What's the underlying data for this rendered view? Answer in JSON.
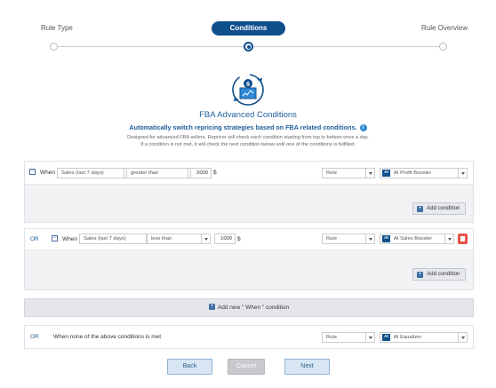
{
  "stepper": {
    "steps": [
      "Rule Type",
      "Conditions",
      "Rule Overview"
    ],
    "active_index": 1
  },
  "header": {
    "title": "FBA Advanced Conditions",
    "subtitle": "Automatically switch repricing strategies based on FBA related conditions.",
    "desc_line1": "Designed for advanced FBA sellers. Repricer will check each condition starting from top to bottom once a day.",
    "desc_line2": "If a condition is not met, it will check the next condition below until one of the conditions is fulfilled."
  },
  "conditions": [
    {
      "prefix": "",
      "when_label": "When",
      "metric": "Sales (last 7 days)",
      "operator": "greater than",
      "value": "2000",
      "unit": "$",
      "action_type": "Rule",
      "ai_badge": "AI",
      "strategy": "AI Profit Booster",
      "add_condition_label": "Add condition"
    },
    {
      "prefix": "OR",
      "when_label": "When",
      "metric": "Sales (last 7 days)",
      "operator": "less than",
      "value": "1000",
      "unit": "$",
      "action_type": "Rule",
      "ai_badge": "AI",
      "strategy": "AI Sales Booster",
      "add_condition_label": "Add condition"
    }
  ],
  "add_when_label": "Add new \" When \" condition",
  "fallback": {
    "prefix": "OR",
    "text": "When none of the above conditions is met",
    "action_type": "Rule",
    "ai_badge": "AI",
    "strategy": "AI Equalizer"
  },
  "footer": {
    "back": "Back",
    "cancel": "Cancel",
    "next": "Next"
  },
  "colors": {
    "primary": "#0f4f8c",
    "danger": "#e5534b",
    "accent_text": "#1f5d99"
  }
}
